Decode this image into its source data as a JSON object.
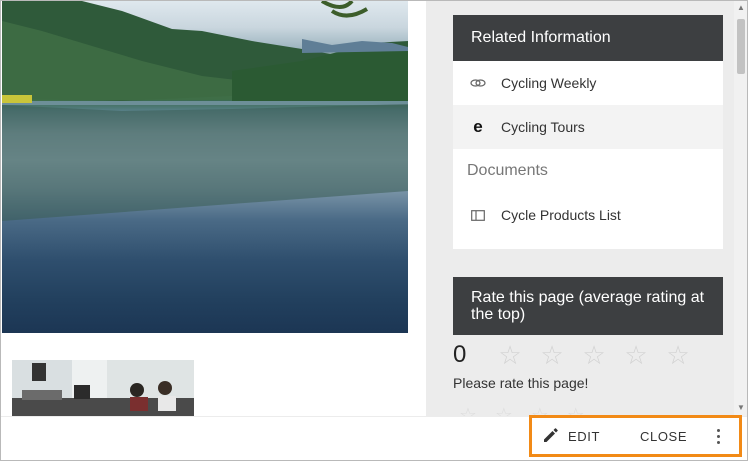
{
  "related": {
    "title": "Related Information",
    "links": [
      {
        "label": "Cycling Weekly",
        "icon": "link-icon"
      },
      {
        "label": "Cycling Tours",
        "icon": "edge-browser-icon"
      }
    ],
    "documents_label": "Documents",
    "documents": [
      {
        "label": "Cycle Products List",
        "icon": "document-panel-icon"
      }
    ]
  },
  "rating": {
    "title": "Rate this page (average rating at the top)",
    "value": "0",
    "stars_total": 5,
    "prompt": "Please rate this page!"
  },
  "actions": {
    "edit_label": "EDIT",
    "close_label": "CLOSE"
  },
  "colors": {
    "header_bg": "#3d3f41",
    "highlight_border": "#f28a16",
    "sidebar_bg": "#ececec"
  }
}
